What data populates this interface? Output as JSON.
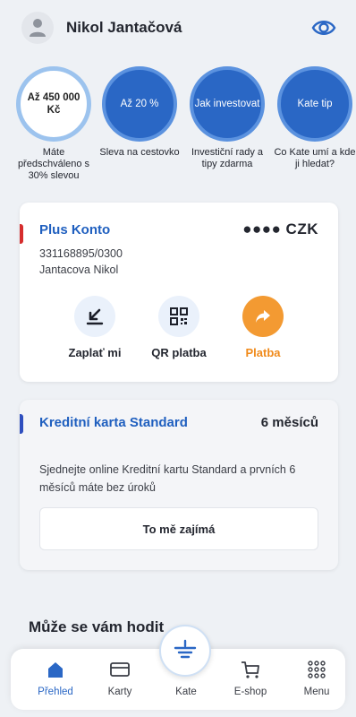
{
  "header": {
    "user_name": "Nikol Jantačová"
  },
  "bubbles": [
    {
      "text": "Až 450 000 Kč",
      "caption": "Máte předschváleno s 30% slevou"
    },
    {
      "text": "Až 20 %",
      "caption": "Sleva na cestovko"
    },
    {
      "text": "Jak investovat",
      "caption": "Investiční rady a tipy zdarma"
    },
    {
      "text": "Kate tip",
      "caption": "Co Kate umí a kde ji hledat?"
    }
  ],
  "account": {
    "name": "Plus Konto",
    "balance_masked": "●●●● CZK",
    "number": "331168895/0300",
    "holder": "Jantacova Nikol",
    "actions": [
      {
        "label": "Zaplať mi"
      },
      {
        "label": "QR platba"
      },
      {
        "label": "Platba"
      }
    ]
  },
  "promo": {
    "title": "Kreditní karta Standard",
    "badge": "6 měsíců",
    "description": "Sjednejte online Kreditní kartu Standard a prvních 6 měsíců máte bez úroků",
    "button_label": "To mě zajímá"
  },
  "section": {
    "title": "Může se vám hodit"
  },
  "bottom_nav": [
    {
      "label": "Přehled",
      "icon": "home-icon",
      "active": true
    },
    {
      "label": "Karty",
      "icon": "card-icon",
      "active": false
    },
    {
      "label": "Kate",
      "icon": "kate-icon",
      "active": false
    },
    {
      "label": "E-shop",
      "icon": "cart-icon",
      "active": false
    },
    {
      "label": "Menu",
      "icon": "grid-icon",
      "active": false
    }
  ],
  "colors": {
    "primary_blue": "#2a67c5",
    "accent_orange": "#f39a32",
    "account_accent": "#d62d2d",
    "promo_accent": "#2f4fbf"
  }
}
